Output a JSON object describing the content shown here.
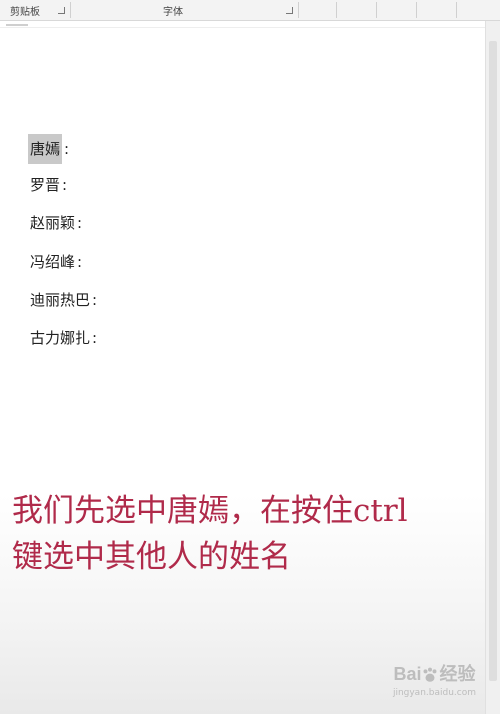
{
  "ribbon": {
    "clipboard_label": "剪贴板",
    "font_label": "字体"
  },
  "document": {
    "names": [
      "唐嫣",
      "罗晋",
      "赵丽颖",
      "冯绍峰",
      "迪丽热巴",
      "古力娜扎"
    ],
    "separator": ":",
    "selected_name": "唐嫣"
  },
  "caption": {
    "line1": "我们先选中唐嫣，在按住ctrl",
    "line2": "键选中其他人的姓名"
  },
  "watermark": {
    "brand_prefix": "Bai",
    "brand_suffix": "经验",
    "sub": "jingyan.baidu.com"
  },
  "colors": {
    "caption": "#b02a4a",
    "selection": "#c9c9c9"
  }
}
